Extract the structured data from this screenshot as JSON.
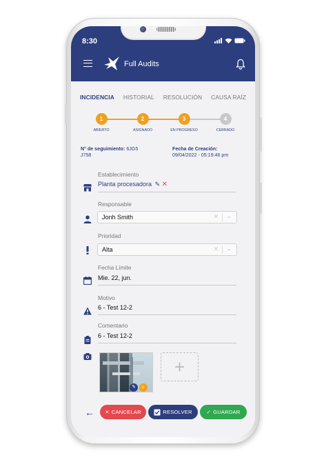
{
  "status_bar": {
    "time": "8:30"
  },
  "header": {
    "app_title": "Full Audits"
  },
  "tabs": [
    {
      "label": "INCIDENCIA",
      "active": true
    },
    {
      "label": "HISTORIAL",
      "active": false
    },
    {
      "label": "RESOLUCIÓN",
      "active": false
    },
    {
      "label": "CAUSA RAÍZ",
      "active": false
    }
  ],
  "stepper": {
    "steps": [
      {
        "number": "1",
        "label": "ABIERTO",
        "color": "#f0a020"
      },
      {
        "number": "2",
        "label": "ASIGNADO",
        "color": "#f0a020"
      },
      {
        "number": "3",
        "label": "EN PROGRESO",
        "color": "#f0a020"
      },
      {
        "number": "4",
        "label": "CERRADO",
        "color": "#c8c8c8"
      }
    ]
  },
  "tracking": {
    "number_label": "N° de seguimiento:",
    "number_value_1": "6JG5",
    "number_value_2": "J758",
    "date_label": "Fecha de Creación:",
    "date_value": "09/04/2022 - 05:19:46 pm"
  },
  "form": {
    "establishment": {
      "label": "Establecimiento",
      "value": "Planta procesadora"
    },
    "responsible": {
      "label": "Responsable",
      "value": "Jonh Smith"
    },
    "priority": {
      "label": "Prioridad",
      "value": "Alta"
    },
    "deadline": {
      "label": "Fecha Límite",
      "value": "Mie. 22, jun."
    },
    "reason": {
      "label": "Motivo",
      "value": "6 - Test 12-2"
    },
    "comment": {
      "label": "Comentario",
      "value": "6 - Test 12-2"
    }
  },
  "actions": {
    "cancel": "CANCELAR",
    "resolve": "RESOLVER",
    "save": "GUARDAR"
  },
  "colors": {
    "primary": "#2c3e7e",
    "accent": "#f0a020",
    "danger": "#e5484d",
    "success": "#2fa84f"
  }
}
